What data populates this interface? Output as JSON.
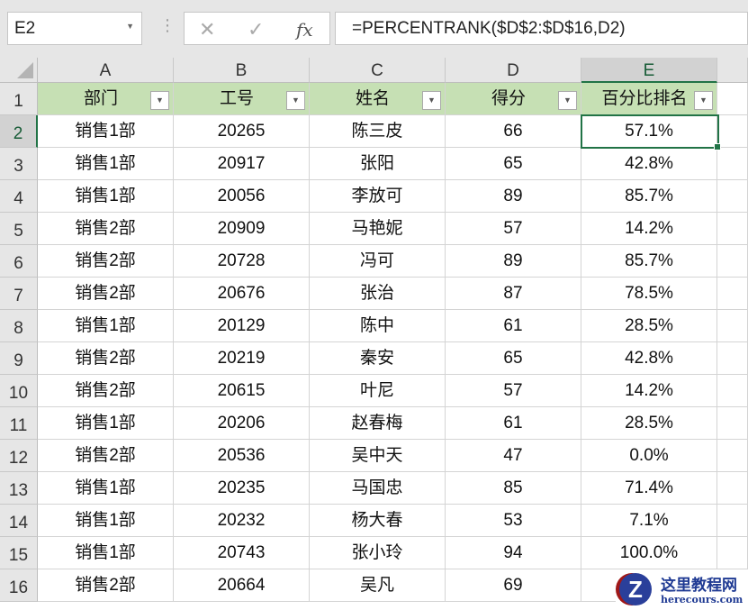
{
  "name_box": "E2",
  "formula": "=PERCENTRANK($D$2:$D$16,D2)",
  "fx_label": "fx",
  "columns": [
    "A",
    "B",
    "C",
    "D",
    "E"
  ],
  "headers": [
    "部门",
    "工号",
    "姓名",
    "得分",
    "百分比排名"
  ],
  "rows": [
    [
      "销售1部",
      "20265",
      "陈三皮",
      "66",
      "57.1%"
    ],
    [
      "销售1部",
      "20917",
      "张阳",
      "65",
      "42.8%"
    ],
    [
      "销售1部",
      "20056",
      "李放可",
      "89",
      "85.7%"
    ],
    [
      "销售2部",
      "20909",
      "马艳妮",
      "57",
      "14.2%"
    ],
    [
      "销售2部",
      "20728",
      "冯可",
      "89",
      "85.7%"
    ],
    [
      "销售2部",
      "20676",
      "张治",
      "87",
      "78.5%"
    ],
    [
      "销售1部",
      "20129",
      "陈中",
      "61",
      "28.5%"
    ],
    [
      "销售2部",
      "20219",
      "秦安",
      "65",
      "42.8%"
    ],
    [
      "销售2部",
      "20615",
      "叶尼",
      "57",
      "14.2%"
    ],
    [
      "销售1部",
      "20206",
      "赵春梅",
      "61",
      "28.5%"
    ],
    [
      "销售2部",
      "20536",
      "吴中天",
      "47",
      "0.0%"
    ],
    [
      "销售1部",
      "20235",
      "马国忠",
      "85",
      "71.4%"
    ],
    [
      "销售1部",
      "20232",
      "杨大春",
      "53",
      "7.1%"
    ],
    [
      "销售1部",
      "20743",
      "张小玲",
      "94",
      "100.0%"
    ],
    [
      "销售2部",
      "20664",
      "吴凡",
      "69",
      ""
    ]
  ],
  "watermark": {
    "title": "这里教程网",
    "url": "herecours.com"
  }
}
